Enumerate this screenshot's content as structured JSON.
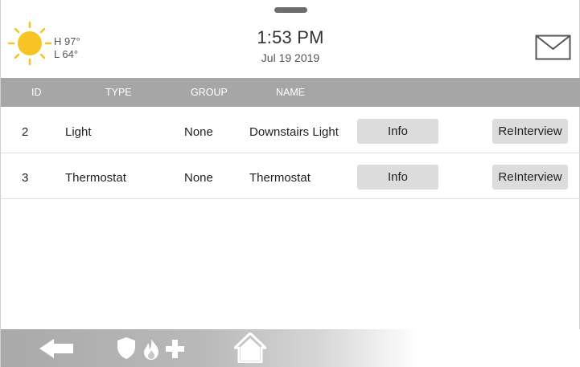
{
  "header": {
    "weather": {
      "icon": "sun-icon",
      "high": "H 97°",
      "low": "L 64°"
    },
    "time": "1:53 PM",
    "date": "Jul 19 2019",
    "mail_icon": "envelope-icon"
  },
  "table": {
    "columns": [
      "ID",
      "TYPE",
      "GROUP",
      "NAME"
    ],
    "rows": [
      {
        "id": "2",
        "type": "Light",
        "group": "None",
        "name": "Downstairs Light",
        "info_label": "Info",
        "reinterview_label": "ReInterview"
      },
      {
        "id": "3",
        "type": "Thermostat",
        "group": "None",
        "name": "Thermostat",
        "info_label": "Info",
        "reinterview_label": "ReInterview"
      }
    ]
  },
  "bottom_bar": {
    "icons": [
      "back-arrow-icon",
      "shield-icon",
      "fire-icon",
      "medical-cross-icon",
      "home-icon"
    ]
  },
  "colors": {
    "sun": "#f7c325",
    "header_bar": "#a6a6a6",
    "button_bg": "#dcdcdc"
  }
}
